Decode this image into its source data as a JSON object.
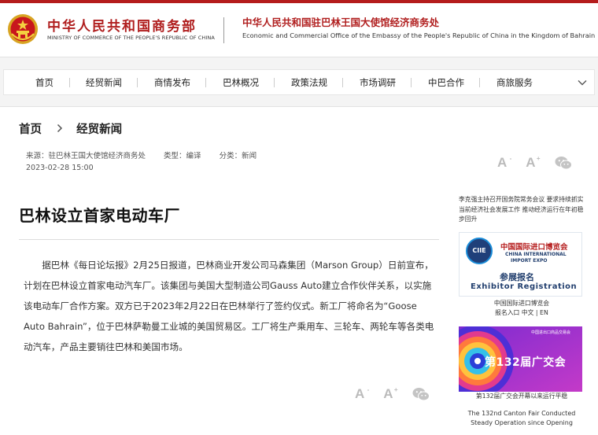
{
  "header": {
    "ministry_cn": "中华人民共和国商务部",
    "ministry_en": "MINISTRY OF COMMERCE OF THE PEOPLE'S REPUBLIC OF CHINA",
    "office_cn": "中华人民共和国驻巴林王国大使馆经济商务处",
    "office_en": "Economic and Commercial Office of the Embassy of the People's Republic of China in the Kingdom of Bahrain",
    "accent_color": "#b51c1c"
  },
  "nav": {
    "items": [
      "首页",
      "经贸新闻",
      "商情发布",
      "巴林概况",
      "政策法规",
      "市场调研",
      "中巴合作",
      "商旅服务"
    ],
    "more_icon": "chevron-down-icon"
  },
  "breadcrumb": {
    "home": "首页",
    "section": "经贸新闻"
  },
  "meta": {
    "source": "来源：驻巴林王国大使馆经济商务处",
    "type": "类型：编译",
    "category": "分类：新闻",
    "date": "2023-02-28 15:00"
  },
  "tools": {
    "font_small": "A",
    "font_large": "A",
    "minus": "-",
    "plus": "+",
    "share_icon": "wechat-icon"
  },
  "article": {
    "title": "巴林设立首家电动车厂",
    "body": "据巴林《每日论坛报》2月25日报道，巴林商业开发公司马森集团（Marson Group）日前宣布，计划在巴林设立首家电动汽车厂。该集团与美国大型制造公司Gauss Auto建立合作伙伴关系，以实施该电动车厂合作方案。双方已于2023年2月22日在巴林举行了签约仪式。新工厂将命名为“Goose Auto Bahrain”，位于巴林萨勒曼工业城的美国贸易区。工厂将生产乘用车、三轮车、两轮车等各类电动汽车，产品主要销往巴林和美国市场。"
  },
  "sidebar": {
    "news_link": "李克强主持召开国务院常务会议 要求持续抓实当前经济社会发展工作 推动经济运行在年初稳步回升",
    "ciie": {
      "logo_text": "CIIE",
      "banner_cn": "中国国际进口博览会",
      "banner_en_1": "CHINA INTERNATIONAL",
      "banner_en_2": "IMPORT EXPO",
      "register_cn": "参展报名",
      "register_en": "Exhibitor Registration",
      "caption": "中国国际进口博览会",
      "entry_label": "报名入口",
      "lang_cn": "中文",
      "lang_sep": "|",
      "lang_en": "EN"
    },
    "canton": {
      "banner_title": "第132届广交会",
      "banner_tag": "中国进出口商品交易会",
      "caption_cn": "第132届广交会开幕以来运行平稳",
      "caption_en": "The 132nd Canton Fair Conducted Steady Operation since Opening"
    }
  }
}
